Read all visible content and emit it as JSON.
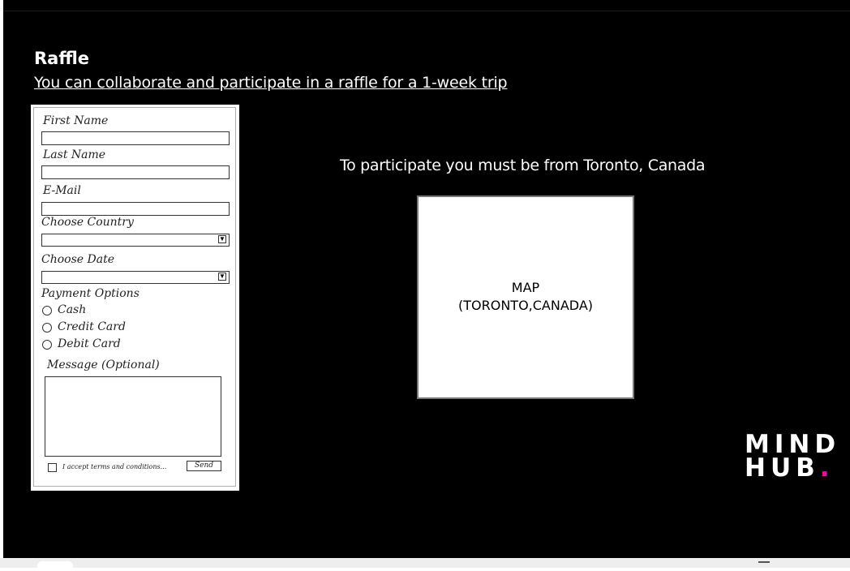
{
  "header": {
    "title": "Raffle",
    "subtitle": "You can collaborate and participate in a raffle for a 1-week trip"
  },
  "form": {
    "first_name_label": "First Name",
    "last_name_label": "Last Name",
    "email_label": "E-Mail",
    "country_label": "Choose Country",
    "date_label": "Choose Date",
    "payment_label": "Payment Options",
    "payment_options": [
      "Cash",
      "Credit Card",
      "Debit Card"
    ],
    "message_label": "Message (Optional)",
    "terms_label": "I accept terms and conditions...",
    "send_label": "Send"
  },
  "info": {
    "participate_text": "To participate you must be from Toronto, Canada",
    "map_line1": "MAP",
    "map_line2": "(TORONTO,CANADA)"
  },
  "logo": {
    "line1": "MIND",
    "line2": "HUB",
    "dot": ".",
    "dot_color": "#e0119e"
  },
  "icons": {
    "dropdown": "chevron-down-icon"
  }
}
